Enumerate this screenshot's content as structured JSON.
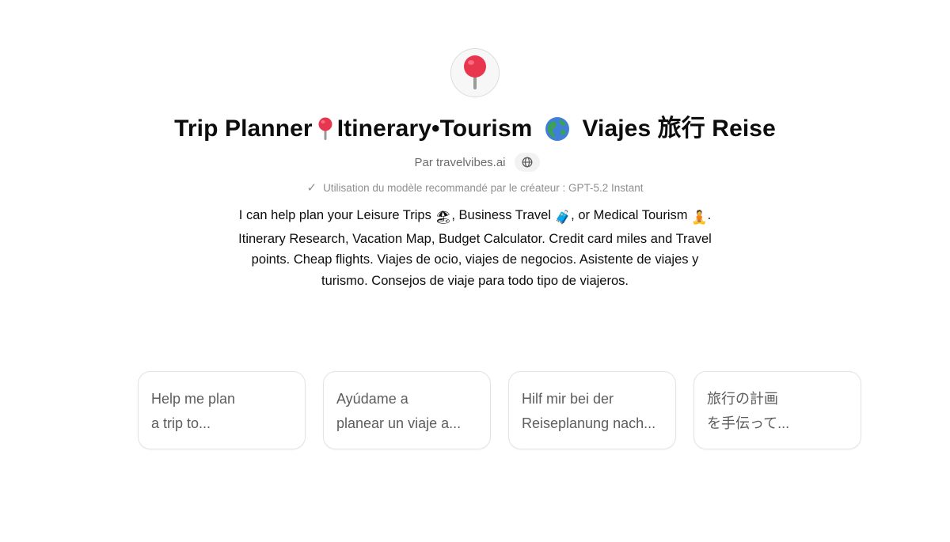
{
  "gpt": {
    "avatar_icon": "round-pushpin-icon",
    "title_part1": "Trip Planner",
    "title_part2": "Itinerary•Tourism",
    "title_part3": "Viajes 旅行 Reise",
    "author": "Par travelvibes.ai",
    "author_link_icon": "globe-icon",
    "model_note": "Utilisation du modèle recommandé par le créateur : GPT-5.2 Instant",
    "description": {
      "t1": "I can help plan your Leisure Trips ",
      "e1": "🏖",
      "t2": ", Business Travel ",
      "e2": "🧳",
      "t3": ", or Medical Tourism ",
      "e3": "🧘",
      "t4": ". Itinerary Research, Vacation Map, Budget Calculator. Credit card miles and Travel points. Cheap flights. Viajes de ocio, viajes de negocios. Asistente de viajes y turismo. Consejos de viaje para todo tipo de viajeros."
    }
  },
  "starters": [
    {
      "line1": "Help me plan",
      "line2": "a trip to..."
    },
    {
      "line1": "Ayúdame a",
      "line2": "planear un viaje a..."
    },
    {
      "line1": "Hilf mir bei der",
      "line2": "Reiseplanung nach..."
    },
    {
      "line1": "旅行の計画",
      "line2": "を手伝って..."
    }
  ],
  "colors": {
    "pin_red": "#e8364f",
    "pin_needle": "#9a9a9a",
    "globe_ocean": "#3f7fd9",
    "globe_land": "#3aa05a"
  }
}
